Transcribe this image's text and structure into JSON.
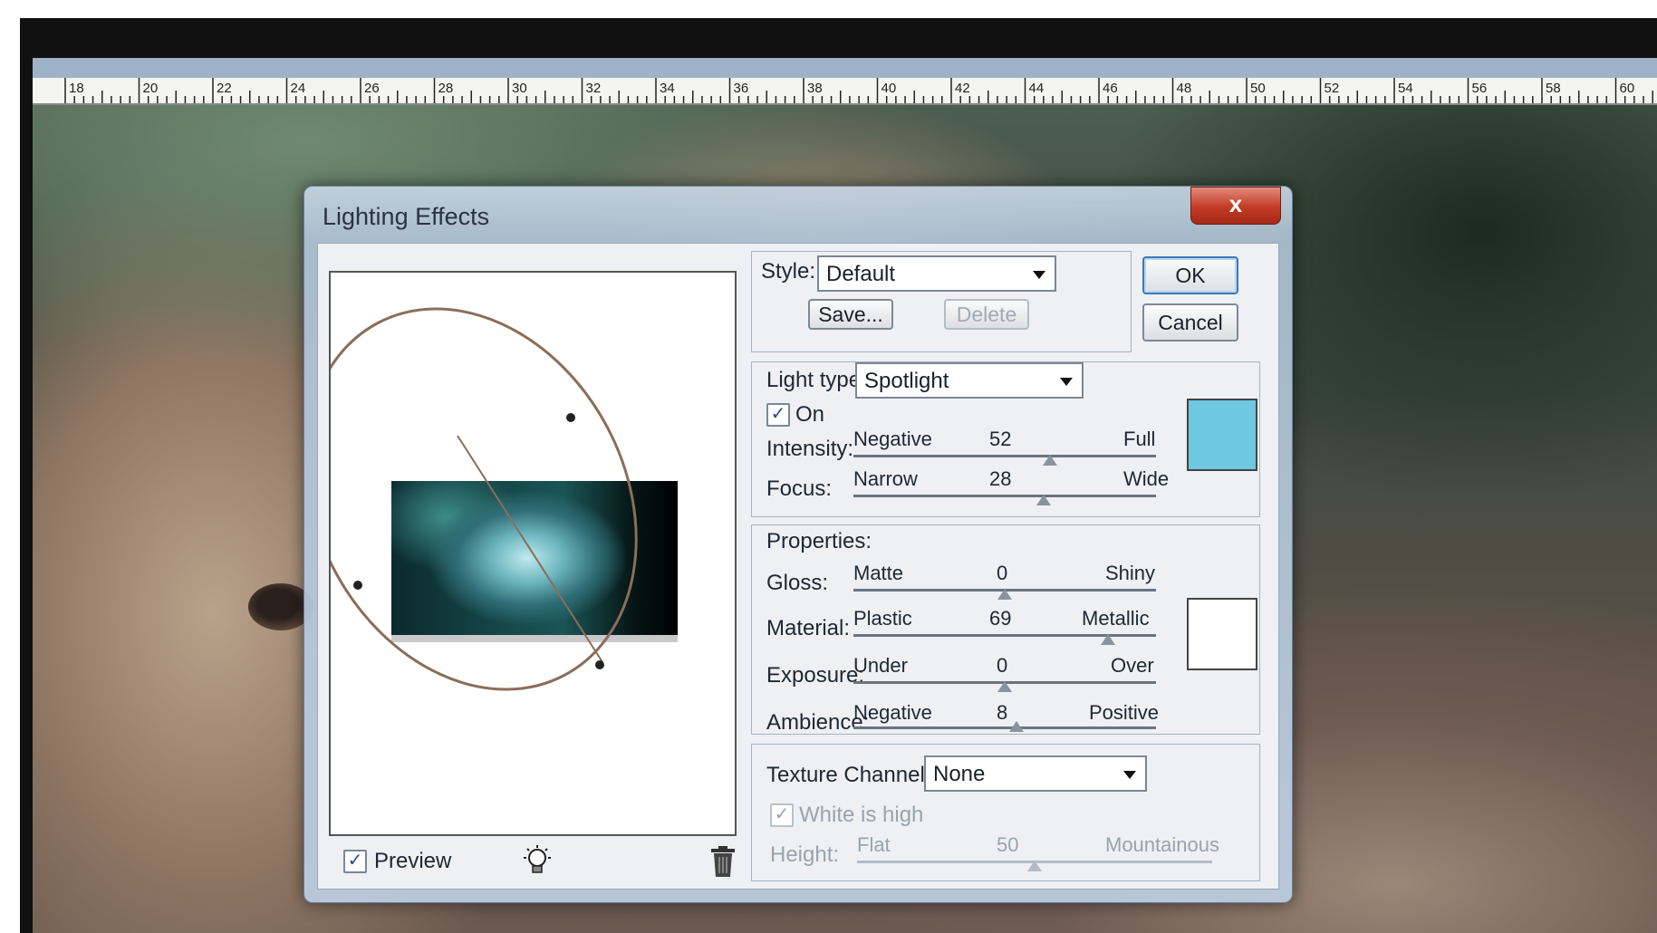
{
  "ruler": {
    "numbers": [
      "18",
      "20",
      "22",
      "24",
      "26",
      "28",
      "30",
      "32",
      "34",
      "36",
      "38",
      "40",
      "42",
      "44",
      "46",
      "48",
      "50",
      "52",
      "54",
      "56",
      "58",
      "60"
    ]
  },
  "dialog": {
    "title": "Lighting Effects",
    "close_label": "x",
    "ok_label": "OK",
    "cancel_label": "Cancel"
  },
  "style_group": {
    "style_label": "Style:",
    "style_value": "Default",
    "save_label": "Save...",
    "delete_label": "Delete"
  },
  "light_group": {
    "light_type_label": "Light type:",
    "light_type_value": "Spotlight",
    "on_label": "On",
    "on_checked": true,
    "intensity": {
      "label": "Intensity:",
      "min": "Negative",
      "max": "Full",
      "value": "52",
      "position": 0.65
    },
    "focus": {
      "label": "Focus:",
      "min": "Narrow",
      "max": "Wide",
      "value": "28",
      "position": 0.63
    },
    "color": "#6ec8e0"
  },
  "properties_group": {
    "title": "Properties:",
    "gloss": {
      "label": "Gloss:",
      "min": "Matte",
      "max": "Shiny",
      "value": "0",
      "position": 0.5
    },
    "material": {
      "label": "Material:",
      "min": "Plastic",
      "max": "Metallic",
      "value": "69",
      "position": 0.84
    },
    "exposure": {
      "label": "Exposure:",
      "min": "Under",
      "max": "Over",
      "value": "0",
      "position": 0.5
    },
    "ambience": {
      "label": "Ambience:",
      "min": "Negative",
      "max": "Positive",
      "value": "8",
      "position": 0.54
    },
    "color": "#ffffff"
  },
  "texture_group": {
    "channel_label": "Texture Channel:",
    "channel_value": "None",
    "white_is_high_label": "White is high",
    "height": {
      "label": "Height:",
      "min": "Flat",
      "max": "Mountainous",
      "value": "50",
      "position": 0.5
    }
  },
  "preview": {
    "preview_label": "Preview",
    "preview_checked": true
  }
}
